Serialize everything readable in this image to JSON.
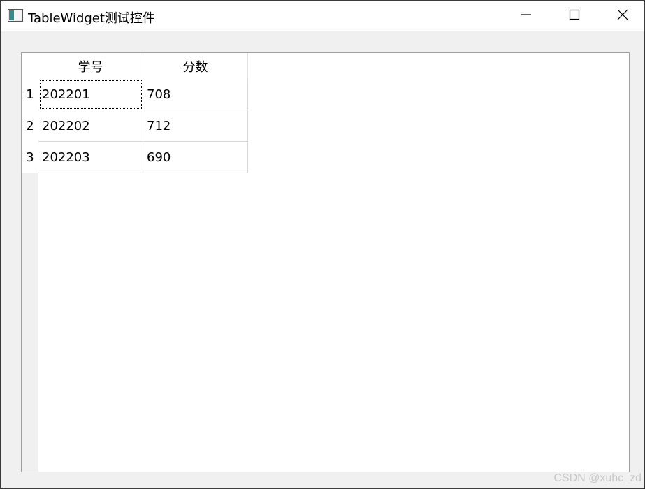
{
  "window": {
    "title": "TableWidget测试控件",
    "icon": "window-app-icon",
    "controls": [
      "minimize-icon",
      "maximize-icon",
      "close-icon"
    ]
  },
  "table": {
    "headers": [
      "学号",
      "分数"
    ],
    "row_numbers": [
      "1",
      "2",
      "3"
    ],
    "rows": [
      [
        "202201",
        "708"
      ],
      [
        "202202",
        "712"
      ],
      [
        "202203",
        "690"
      ]
    ],
    "current_cell": "202201"
  },
  "watermark": "CSDN @xuhc_zd"
}
